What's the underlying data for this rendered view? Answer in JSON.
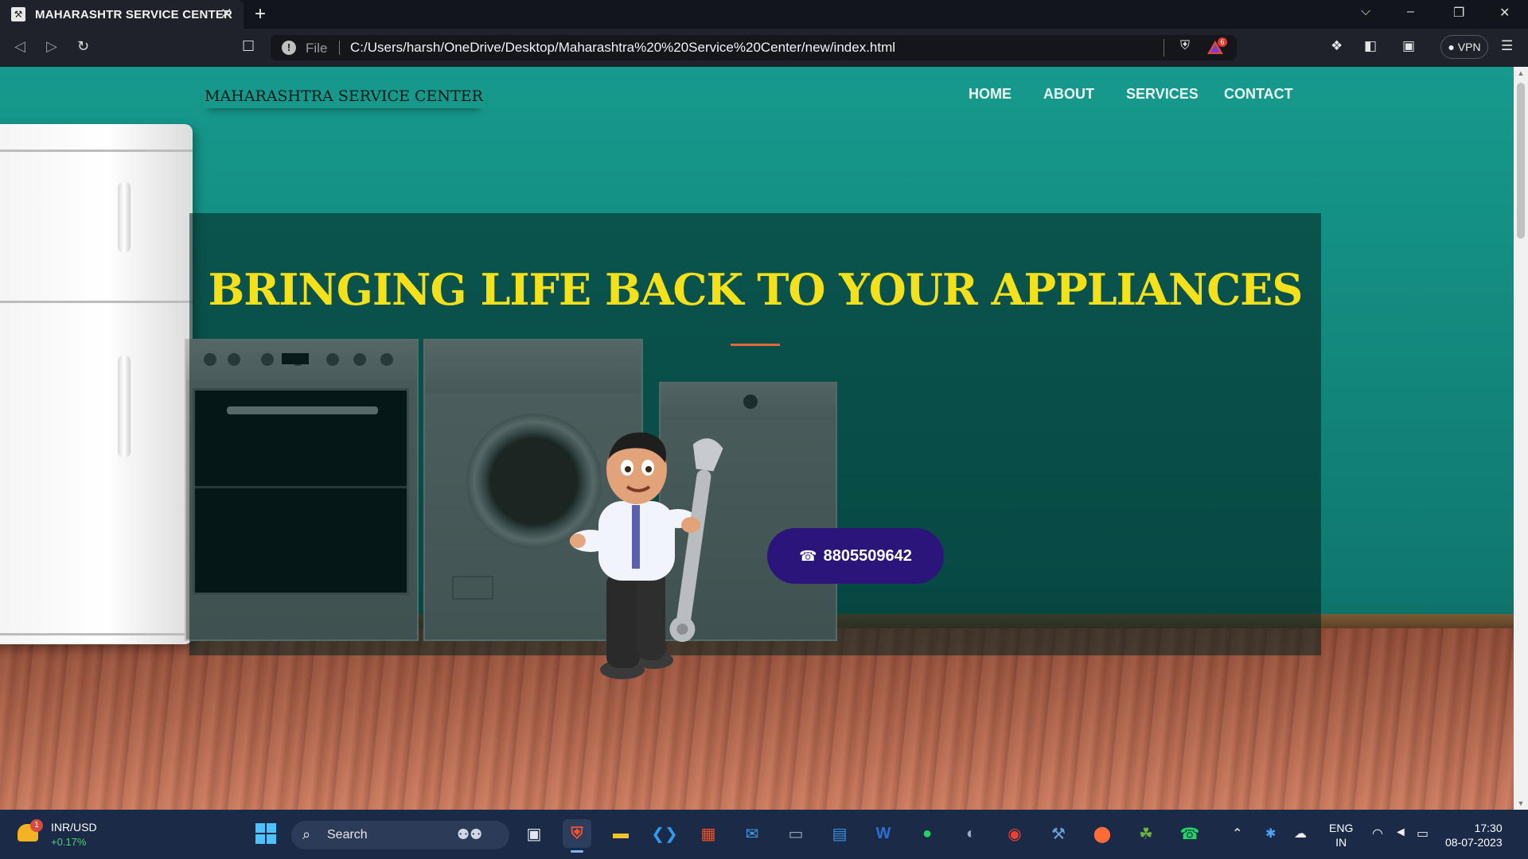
{
  "browser": {
    "tab_title": "MAHARASHTR SERVICE CENTER",
    "url_scheme": "File",
    "url": "C:/Users/harsh/OneDrive/Desktop/Maharashtra%20%20Service%20Center/new/index.html",
    "rewards_count": "6",
    "vpn_label": "VPN"
  },
  "site": {
    "brand": "MAHARASHTRA SERVICE CENTER",
    "nav": [
      "HOME",
      "ABOUT",
      "SERVICES",
      "CONTACT"
    ],
    "hero_title": "BRINGING LIFE BACK TO YOUR APPLIANCES",
    "phone": "8805509642",
    "colors": {
      "hero_bg": "#169a8d",
      "title": "#f5e11a",
      "accent_rule": "#e4673a",
      "call_button": "#2c157a"
    }
  },
  "taskbar": {
    "widget_label": "INR/USD",
    "widget_value": "+0.17%",
    "widget_badge": "1",
    "search_label": "Search",
    "lang_top": "ENG",
    "lang_bottom": "IN",
    "time": "17:30",
    "date": "08-07-2023",
    "apps": [
      "start-icon",
      "copilot-icon",
      "task-view-icon",
      "brave-icon",
      "file-explorer-icon",
      "vscode-icon",
      "microsoft-store-icon",
      "mail-icon",
      "app-icon",
      "widgets-icon",
      "word-icon",
      "spotify-icon",
      "eclipse-icon",
      "chrome-icon",
      "sql-icon",
      "postman-icon",
      "spring-icon",
      "whatsapp-icon"
    ]
  }
}
